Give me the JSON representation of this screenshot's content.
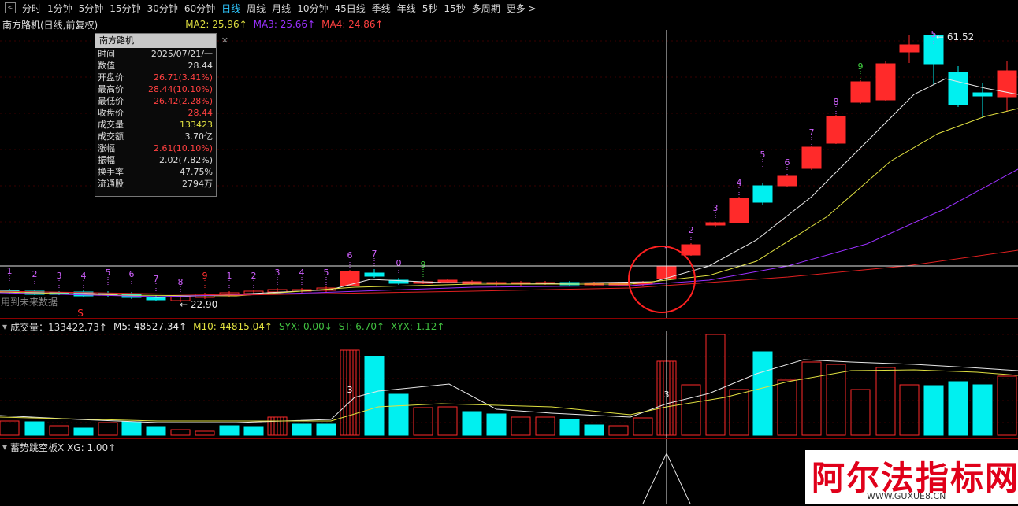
{
  "toolbar": {
    "items": [
      "分时",
      "1分钟",
      "5分钟",
      "15分钟",
      "30分钟",
      "60分钟",
      "日线",
      "周线",
      "月线",
      "10分钟",
      "45日线",
      "季线",
      "年线",
      "5秒",
      "15秒",
      "多周期",
      "更多 >"
    ],
    "active": "日线"
  },
  "main_chart": {
    "title": "南方路机(日线,前复权)",
    "ma2": "MA2: 25.96↑",
    "ma3": "MA3: 25.66↑",
    "ma4": "MA4: 24.86↑",
    "high_label": "61.52",
    "low_label": "22.90",
    "future_note": "用到未来数据",
    "s_marker": "S",
    "count_labels": [
      "1",
      "2",
      "3",
      "4",
      "5",
      "6",
      "7",
      "8",
      "9",
      "1",
      "2",
      "3",
      "4",
      "5",
      "6",
      "7",
      "0",
      "9",
      "1",
      "2",
      "3",
      "4",
      "5",
      "6",
      "7",
      "8",
      "9",
      "5"
    ],
    "colors": {
      "up": "#ff2a2a",
      "down": "#00f0f0",
      "ma_white": "#e8e8e8",
      "ma_yellow": "#e0e040",
      "ma_purple": "#9a30ff",
      "ma_red": "#e02020",
      "highlight": "#ff2020"
    }
  },
  "tooltip": {
    "title": "南方路机",
    "close": "✕",
    "rows": [
      {
        "k": "时间",
        "v": "2025/07/21/一",
        "c": "#ddd"
      },
      {
        "k": "数值",
        "v": "28.44",
        "c": "#ddd"
      },
      {
        "k": "开盘价",
        "v": "26.71(3.41%)",
        "c": "#ff4040"
      },
      {
        "k": "最高价",
        "v": "28.44(10.10%)",
        "c": "#ff4040"
      },
      {
        "k": "最低价",
        "v": "26.42(2.28%)",
        "c": "#ff4040"
      },
      {
        "k": "收盘价",
        "v": "28.44",
        "c": "#ff4040"
      },
      {
        "k": "成交量",
        "v": "133423",
        "c": "#e0e040"
      },
      {
        "k": "成交额",
        "v": "3.70亿",
        "c": "#ddd"
      },
      {
        "k": "涨幅",
        "v": "2.61(10.10%)",
        "c": "#ff4040"
      },
      {
        "k": "振幅",
        "v": "2.02(7.82%)",
        "c": "#ddd"
      },
      {
        "k": "换手率",
        "v": "47.75%",
        "c": "#ddd"
      },
      {
        "k": "流通股",
        "v": "2794万",
        "c": "#ddd"
      }
    ]
  },
  "volume_panel": {
    "label": "成交量：133422.73↑",
    "m5": "M5: 48527.34↑",
    "m10": "M10: 44815.04↑",
    "syx": "SYX: 0.00↓",
    "st": "ST: 6.70↑",
    "xyx": "XYX: 1.12↑",
    "marker": "3"
  },
  "indicator_panel": {
    "label": "蓄势跳空板X XG: 1.00↑"
  },
  "watermark": {
    "big": "阿尔法指标网",
    "small": "WWW.GUXUE8.CN"
  }
}
